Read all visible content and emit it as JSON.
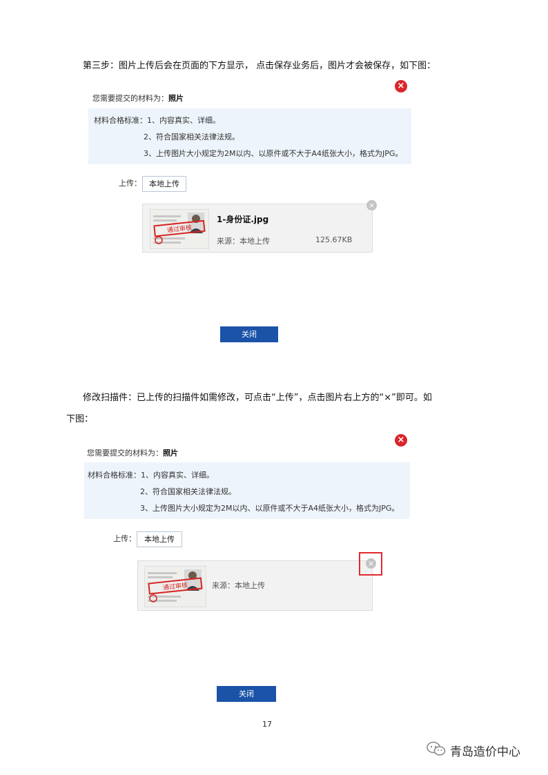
{
  "step3": {
    "text": "第三步：图片上传后会在页面的下方显示，  点击保存业务后，图片才会被保存，如下图："
  },
  "dialog": {
    "required_prefix": "您需要提交的材料为：",
    "required_item": "照片",
    "standard_label": "材料合格标准：",
    "standards": [
      "1、内容真实、详细。",
      "2、符合国家相关法律法规。",
      "3、上传图片大小规定为2M以内、以原件或不大于A4纸张大小，格式为JPG。"
    ],
    "upload_label": "上传：",
    "upload_button": "本地上传",
    "close_button": "关闭",
    "close_icon": "×",
    "remove_icon": "×"
  },
  "file1": {
    "name": "1-身份证.jpg",
    "source": "来源：本地上传",
    "size": "125.67KB",
    "stamp_text": "通过审核"
  },
  "file2": {
    "source": "来源：本地上传",
    "stamp_text": "通过审核"
  },
  "modify": {
    "text_line1": "修改扫描件：已上传的扫描件如需修改，可点击“上传”，点击图片右上方的“×”即可。如",
    "text_line2": "下图："
  },
  "page_number": "17",
  "watermark": "青岛造价中心",
  "colors": {
    "accent_blue": "#1a53a8",
    "close_red": "#d9262b",
    "highlight_red": "#e0292c",
    "panel_bg": "#eef4fb"
  }
}
